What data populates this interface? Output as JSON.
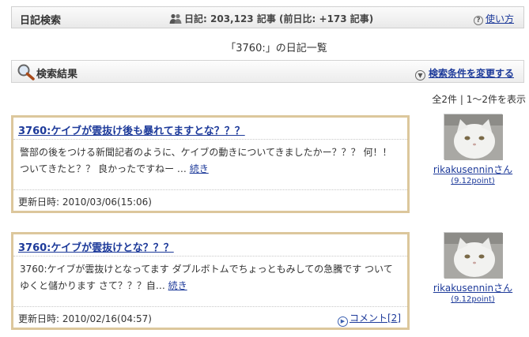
{
  "header": {
    "title": "日記検索",
    "stats_label": "日記:",
    "stats_count": "203,123",
    "stats_unit": "記事",
    "stats_compare": "(前日比: +173 記事)",
    "help_label": "使い方"
  },
  "list_heading": "「3760:」の日記一覧",
  "results": {
    "title": "検索結果",
    "change_label": "検索条件を変更する",
    "count_text": "全2件 | 1〜2件を表示"
  },
  "entries": [
    {
      "title": "3760:ケイブが雲抜け後も暴れてますとな？？？",
      "body": "警部の後をつける新聞記者のように、ケイブの動きについてきましたかー？？？ 何！！ついてきたと？？ 良かったですねー …",
      "more_label": "続き",
      "updated_label": "更新日時:",
      "updated": "2010/03/06(15:06)",
      "author": "rikakusenninさん",
      "points": "(9.12point)"
    },
    {
      "title": "3760:ケイブが雲抜けとな？？？",
      "body": "3760:ケイブが雲抜けとなってます ダブルボトムでちょっともみしての急騰です ついてゆくと儲かります さて？？？自…",
      "more_label": "続き",
      "updated_label": "更新日時:",
      "updated": "2010/02/16(04:57)",
      "comment_label": "コメント[2]",
      "author": "rikakusenninさん",
      "points": "(9.12point)"
    }
  ],
  "colors": {
    "link": "#1d3a9a",
    "card_border": "#dcc79c",
    "header_bg": "#eeeeee"
  }
}
